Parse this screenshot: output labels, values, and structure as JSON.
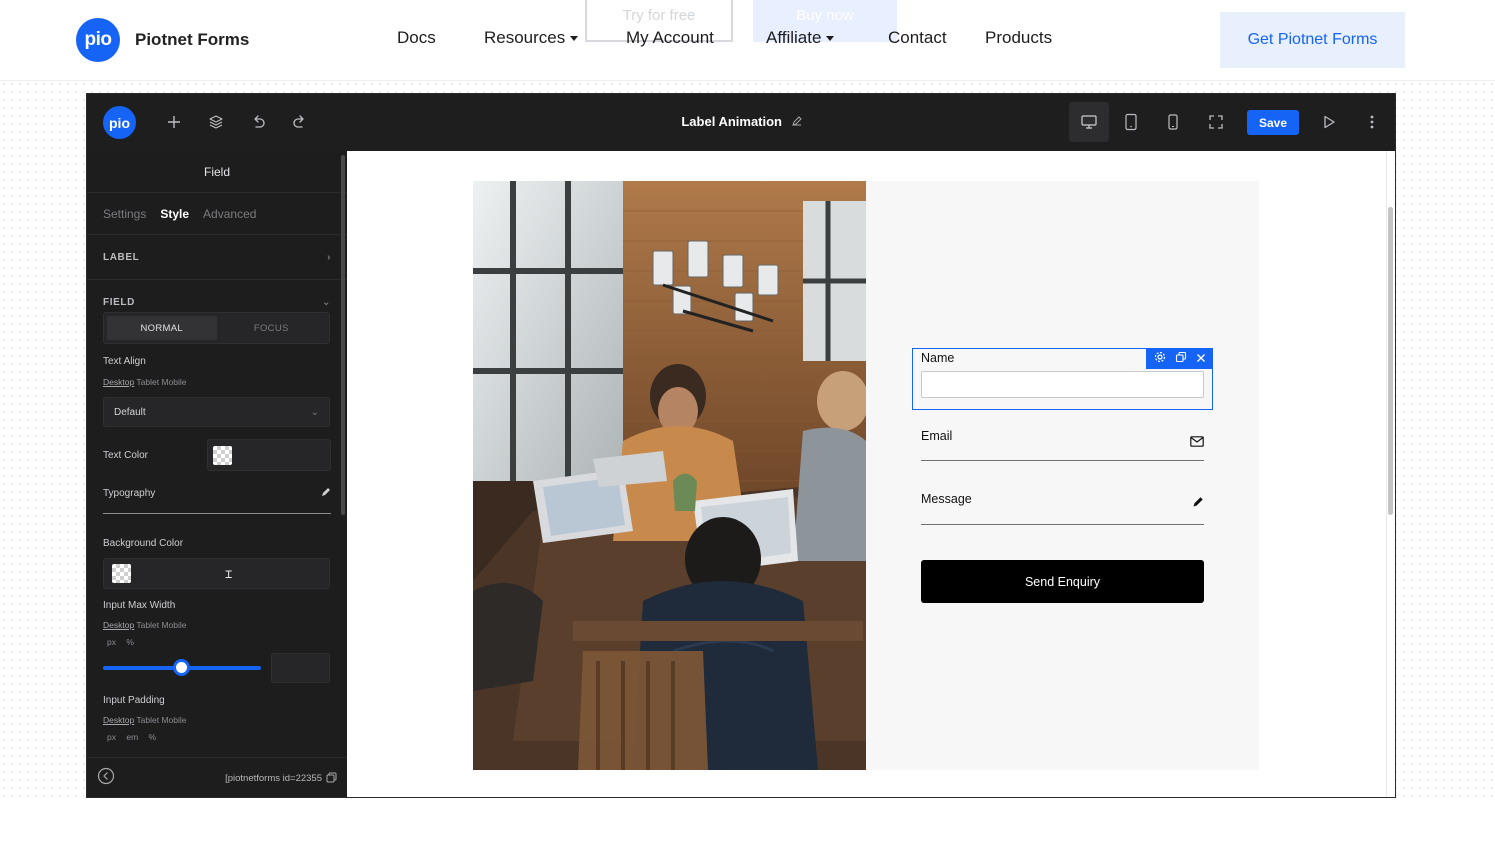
{
  "site": {
    "logo_mark": "pio",
    "logo_text": "Piotnet Forms",
    "ghost_try": "Try for free",
    "ghost_buy": "Buy now",
    "nav": [
      {
        "label": "Docs"
      },
      {
        "label": "Resources"
      },
      {
        "label": "My Account"
      },
      {
        "label": "Affiliate"
      },
      {
        "label": "Contact"
      },
      {
        "label": "Products"
      }
    ],
    "cta": "Get Piotnet Forms",
    "accent_color": "#1664f5"
  },
  "builder": {
    "logo_mark": "pio",
    "title": "Label Animation",
    "toolbar_icons": [
      "plus-icon",
      "layers-icon",
      "undo-icon",
      "redo-icon",
      "pencil-icon",
      "desktop-icon",
      "tablet-icon",
      "mobile-icon",
      "fullscreen-icon",
      "preview-play-icon",
      "more-icon"
    ],
    "save_label": "Save"
  },
  "sidebar": {
    "header": "Field",
    "tabs": [
      "Settings",
      "Style",
      "Advanced"
    ],
    "active_tab": "Style",
    "sections": {
      "label": "LABEL",
      "field": "FIELD"
    },
    "state_toggle": [
      "NORMAL",
      "FOCUS"
    ],
    "text_align": {
      "label": "Text Align",
      "devices": [
        "Desktop",
        "Tablet",
        "Mobile"
      ],
      "value": "Default"
    },
    "text_color": {
      "label": "Text Color"
    },
    "typography": {
      "label": "Typography"
    },
    "background_color": {
      "label": "Background Color"
    },
    "input_max_width": {
      "label": "Input Max Width",
      "devices": [
        "Desktop",
        "Tablet",
        "Mobile"
      ],
      "units": [
        "px",
        "%"
      ]
    },
    "input_padding": {
      "label": "Input Padding",
      "devices": [
        "Desktop",
        "Tablet",
        "Mobile"
      ],
      "units": [
        "px",
        "em",
        "%"
      ]
    },
    "shortcode": "[piotnetforms id=22355"
  },
  "form": {
    "name_label": "Name",
    "email_label": "Email",
    "message_label": "Message",
    "submit_label": "Send Enquiry"
  }
}
